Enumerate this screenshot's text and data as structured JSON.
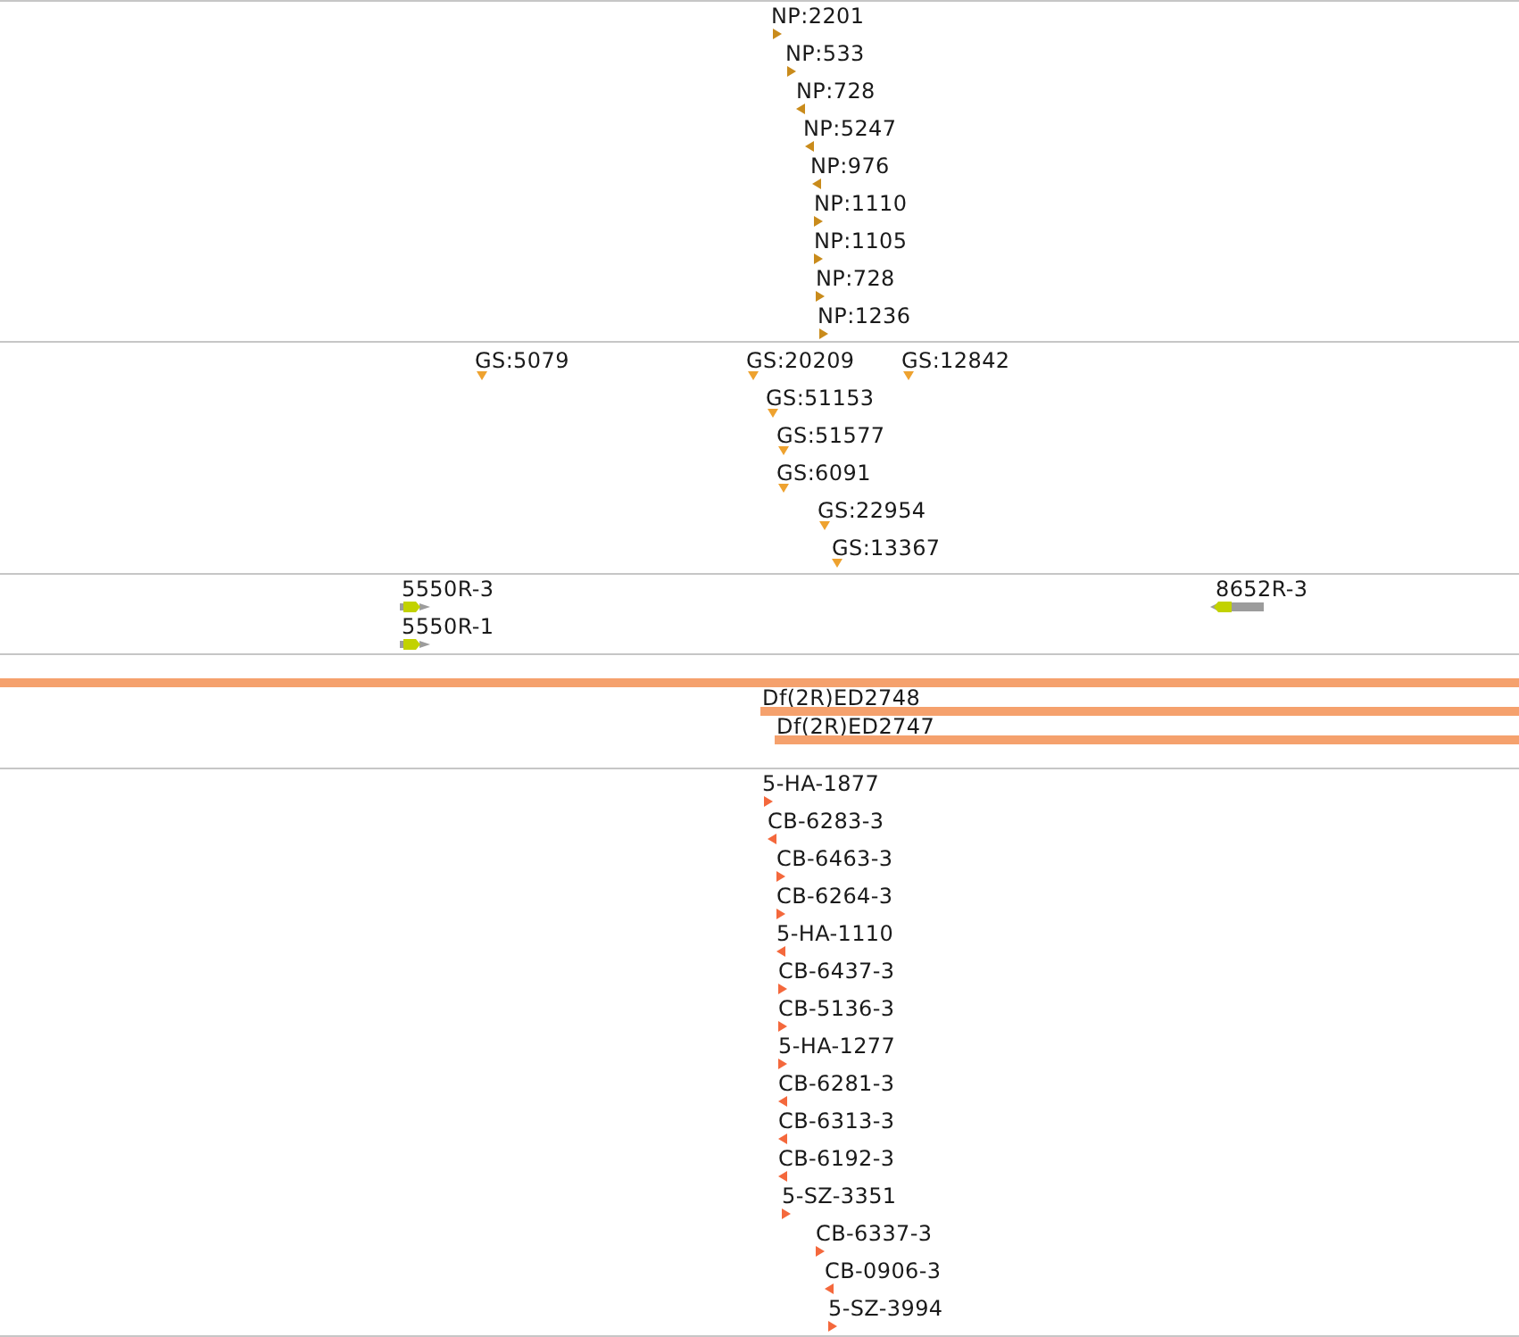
{
  "tracks": [
    {
      "kind": "oriented",
      "color": "#c98b1b",
      "features": [
        {
          "label": "NP:2201",
          "forward": true
        },
        {
          "label": "NP:533",
          "forward": true
        },
        {
          "label": "NP:728",
          "forward": false
        },
        {
          "label": "NP:5247",
          "forward": false
        },
        {
          "label": "NP:976",
          "forward": false
        },
        {
          "label": "NP:1110",
          "forward": true
        },
        {
          "label": "NP:1105",
          "forward": true
        },
        {
          "label": "NP:728",
          "forward": true
        },
        {
          "label": "NP:1236",
          "forward": true
        }
      ]
    },
    {
      "kind": "unoriented",
      "color": "#eea22f",
      "features": [
        {
          "label": "GS:5079"
        },
        {
          "label": "GS:20209"
        },
        {
          "label": "GS:12842"
        },
        {
          "label": "GS:51153"
        },
        {
          "label": "GS:51577"
        },
        {
          "label": "GS:6091"
        },
        {
          "label": "GS:22954"
        },
        {
          "label": "GS:13367"
        }
      ]
    },
    {
      "kind": "gene",
      "color": "#c2d200",
      "features": [
        {
          "label": "5550R-3",
          "forward": true
        },
        {
          "label": "5550R-1",
          "forward": true
        },
        {
          "label": "8652R-3",
          "forward": false
        }
      ]
    },
    {
      "kind": "span",
      "color": "#f5a16d",
      "features": [
        {
          "clipped_left": true
        },
        {
          "label": "Df(2R)ED2748",
          "clipped_left": false
        },
        {
          "label": "Df(2R)ED2747",
          "clipped_left": false
        }
      ]
    },
    {
      "kind": "oriented",
      "color": "#f4683c",
      "features": [
        {
          "label": "5-HA-1877",
          "forward": true
        },
        {
          "label": "CB-6283-3",
          "forward": false
        },
        {
          "label": "CB-6463-3",
          "forward": true
        },
        {
          "label": "CB-6264-3",
          "forward": true
        },
        {
          "label": "5-HA-1110",
          "forward": false
        },
        {
          "label": "CB-6437-3",
          "forward": true
        },
        {
          "label": "CB-5136-3",
          "forward": true
        },
        {
          "label": "5-HA-1277",
          "forward": true
        },
        {
          "label": "CB-6281-3",
          "forward": false
        },
        {
          "label": "CB-6313-3",
          "forward": false
        },
        {
          "label": "CB-6192-3",
          "forward": false
        },
        {
          "label": "5-SZ-3351",
          "forward": true
        },
        {
          "label": "CB-6337-3",
          "forward": true
        },
        {
          "label": "CB-0906-3",
          "forward": false
        },
        {
          "label": "5-SZ-3994",
          "forward": true
        }
      ]
    }
  ]
}
